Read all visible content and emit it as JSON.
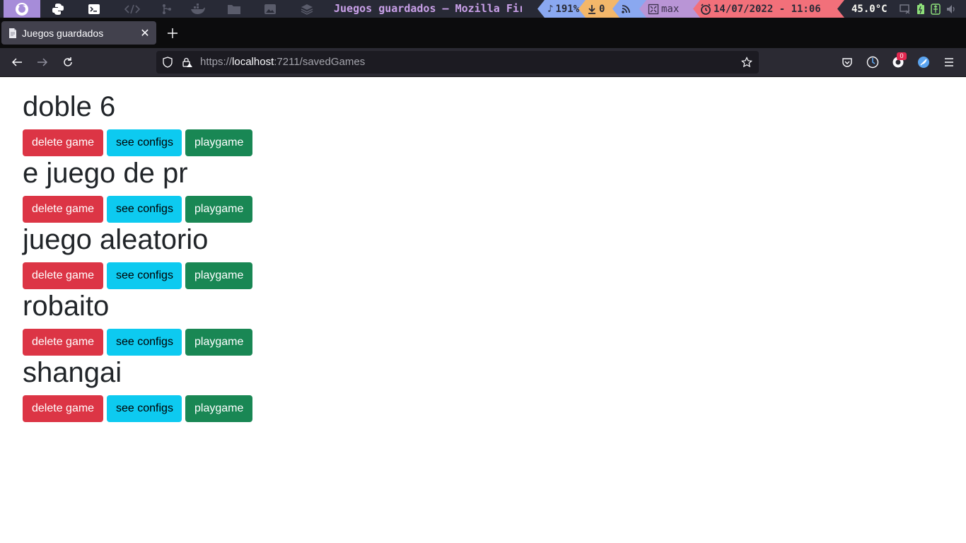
{
  "system_bar": {
    "window_title": "Juegos guardados — Mozilla Firefox",
    "volume": "191%",
    "downloads": "0",
    "layout": "max",
    "datetime": "14/07/2022 - 11:06",
    "temperature": "45.0°C",
    "colors": {
      "bar_bg": "#282a36",
      "active_ws": "#a68cd9",
      "volume": "#8aa8f0",
      "downloads": "#f3b76a",
      "layout": "#b995d6",
      "date": "#f2707a"
    }
  },
  "browser": {
    "tab": {
      "title": "Juegos guardados"
    },
    "url": {
      "scheme": "https://",
      "host": "localhost",
      "rest": ":7211/savedGames"
    }
  },
  "extensions": {
    "ublock_count": "0"
  },
  "games": [
    {
      "name": "doble 6"
    },
    {
      "name": "e juego de pr"
    },
    {
      "name": "juego aleatorio"
    },
    {
      "name": "robaito"
    },
    {
      "name": "shangai"
    }
  ],
  "buttons": {
    "delete": "delete game",
    "configs": "see configs",
    "play": "playgame"
  },
  "theme": {
    "danger": "#dc3545",
    "info": "#0dcaf0",
    "success": "#198754",
    "text": "#212529"
  }
}
